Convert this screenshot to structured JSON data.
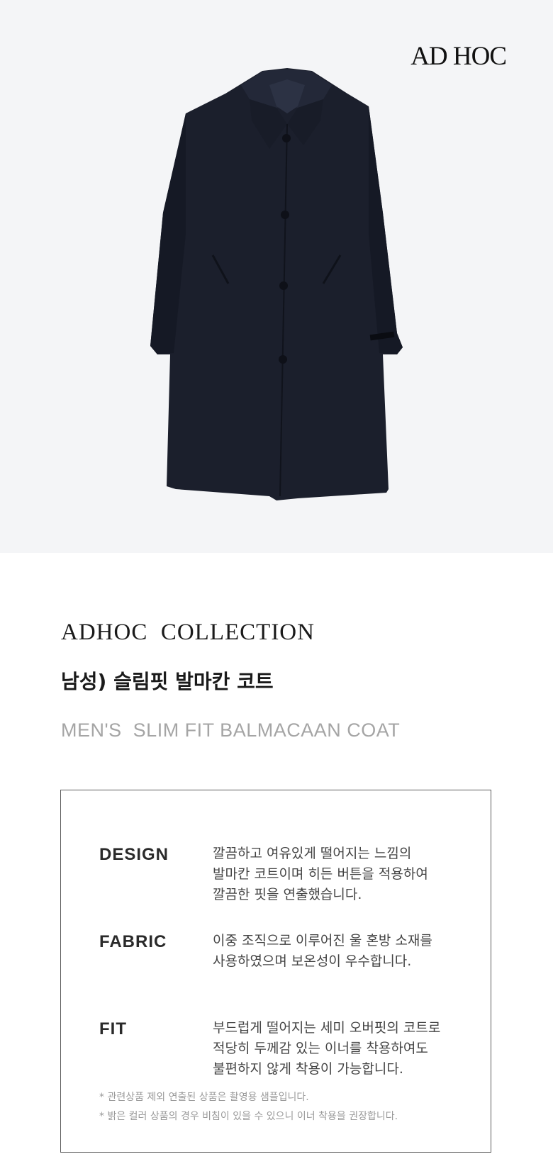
{
  "brand": {
    "logo_text": "AD HOC"
  },
  "product": {
    "image_alt": "navy balmacaan coat",
    "collection": "ADHOC  COLLECTION",
    "title_kr": "남성) 슬림핏 발마칸 코트",
    "title_en": "MEN'S  SLIM FIT BALMACAAN COAT"
  },
  "specs": [
    {
      "label": "DESIGN",
      "text": "깔끔하고 여유있게 떨어지는 느낌의\n발마칸 코트이며 히든 버튼을 적용하여\n깔끔한 핏을 연출했습니다."
    },
    {
      "label": "FABRIC",
      "text": "이중 조직으로 이루어진 울 혼방 소재를\n사용하였으며 보온성이 우수합니다."
    },
    {
      "label": "FIT",
      "text": "부드럽게 떨어지는 세미 오버핏의 코트로\n적당히 두께감 있는 이너를 착용하여도\n불편하지 않게 착용이 가능합니다."
    }
  ],
  "notes": [
    "* 관련상품 제외 연출된 상품은 촬영용 샘플입니다.",
    "* 밝은 컬러 상품의 경우 비침이 있을 수 있으니 이너 착용을 권장합니다."
  ],
  "colors": {
    "coat": "#1b1f2c",
    "background": "#f4f5f7"
  }
}
